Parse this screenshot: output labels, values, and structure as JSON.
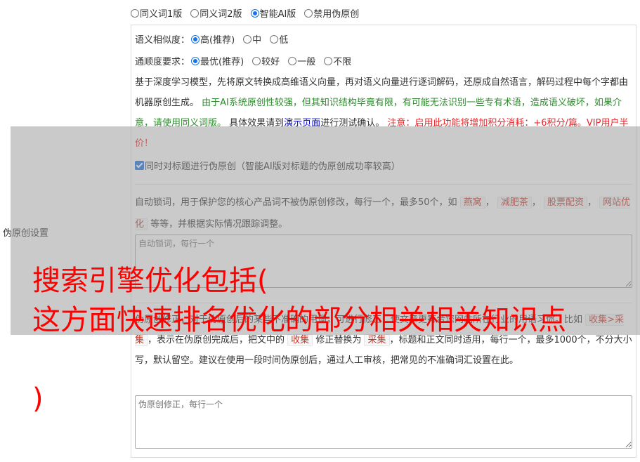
{
  "modes": [
    {
      "label": "同义词1版",
      "checked": false
    },
    {
      "label": "同义词2版",
      "checked": false
    },
    {
      "label": "智能AI版",
      "checked": true
    },
    {
      "label": "禁用伪原创",
      "checked": false
    }
  ],
  "side_label": "伪原创设置",
  "similarity": {
    "label": "语义相似度：",
    "options": [
      {
        "label": "高(推荐)",
        "checked": true
      },
      {
        "label": "中",
        "checked": false
      },
      {
        "label": "低",
        "checked": false
      }
    ]
  },
  "fluency": {
    "label": "通顺度要求：",
    "options": [
      {
        "label": "最优(推荐)",
        "checked": true
      },
      {
        "label": "较好",
        "checked": false
      },
      {
        "label": "一般",
        "checked": false
      },
      {
        "label": "不限",
        "checked": false
      }
    ]
  },
  "description": {
    "part1": "基于深度学习模型，先将原文转换成高维语义向量，再对语义向量进行逐词解码，还原成自然语言，解码过程中每个字都由机器原创生成。",
    "part2_green": "由于AI系统原创性较强，但其知识结构毕竟有限，有可能无法识别一些专有术语，造成语义破坏，如果介意，请使用同义词版。",
    "part3_prefix": "具体效果请到",
    "part3_link": "演示页面",
    "part3_suffix": "进行测试确认。",
    "part4_red": "注意：启用此功能将增加积分消耗：+6积分/篇。VIP用户半价！"
  },
  "title_checkbox": {
    "label": "同时对标题进行伪原创（智能AI版对标题的伪原创成功率较高）",
    "checked": true
  },
  "lock_words": {
    "desc_prefix": "自动锁词，用于保护您的核心产品词不被伪原创修改，每行一个，最多50个，如",
    "examples": [
      "燕窝",
      "减肥茶",
      "股票配资",
      "网站优化"
    ],
    "desc_suffix": "等等，并根据实际情况跟踪调整。",
    "placeholder": "自动锁词，每行一个"
  },
  "corrections": {
    "desc_prefix": "伪原创修正，对于伪原创后的某些不准确的用词，可进行修正，使文章更符合您网站所在行业的用语习惯。比如",
    "example": "收集>采集",
    "desc_middle": "，表示在伪原创完成后，把文中的",
    "from_word": "收集",
    "desc_middle2": "修正替换为",
    "to_word": "采集",
    "desc_suffix": "，标题和正文同时适用，每行一个，最多1000个，不分大小写，默认留空。建议在使用一段时间伪原创后，通过人工审核，把常见的不准确词汇设置在此。",
    "placeholder": "伪原创修正，每行一个"
  },
  "overlay_headline": {
    "line1": "搜索引擎优化包括(",
    "line2": "这方面快速排名优化的部分相关相关知识点",
    "line3": ")"
  },
  "colors": {
    "accent": "#1a73e8",
    "green": "#2e8b2e",
    "red": "#e8262a",
    "link": "#0000cc",
    "headline": "#ff0000"
  }
}
